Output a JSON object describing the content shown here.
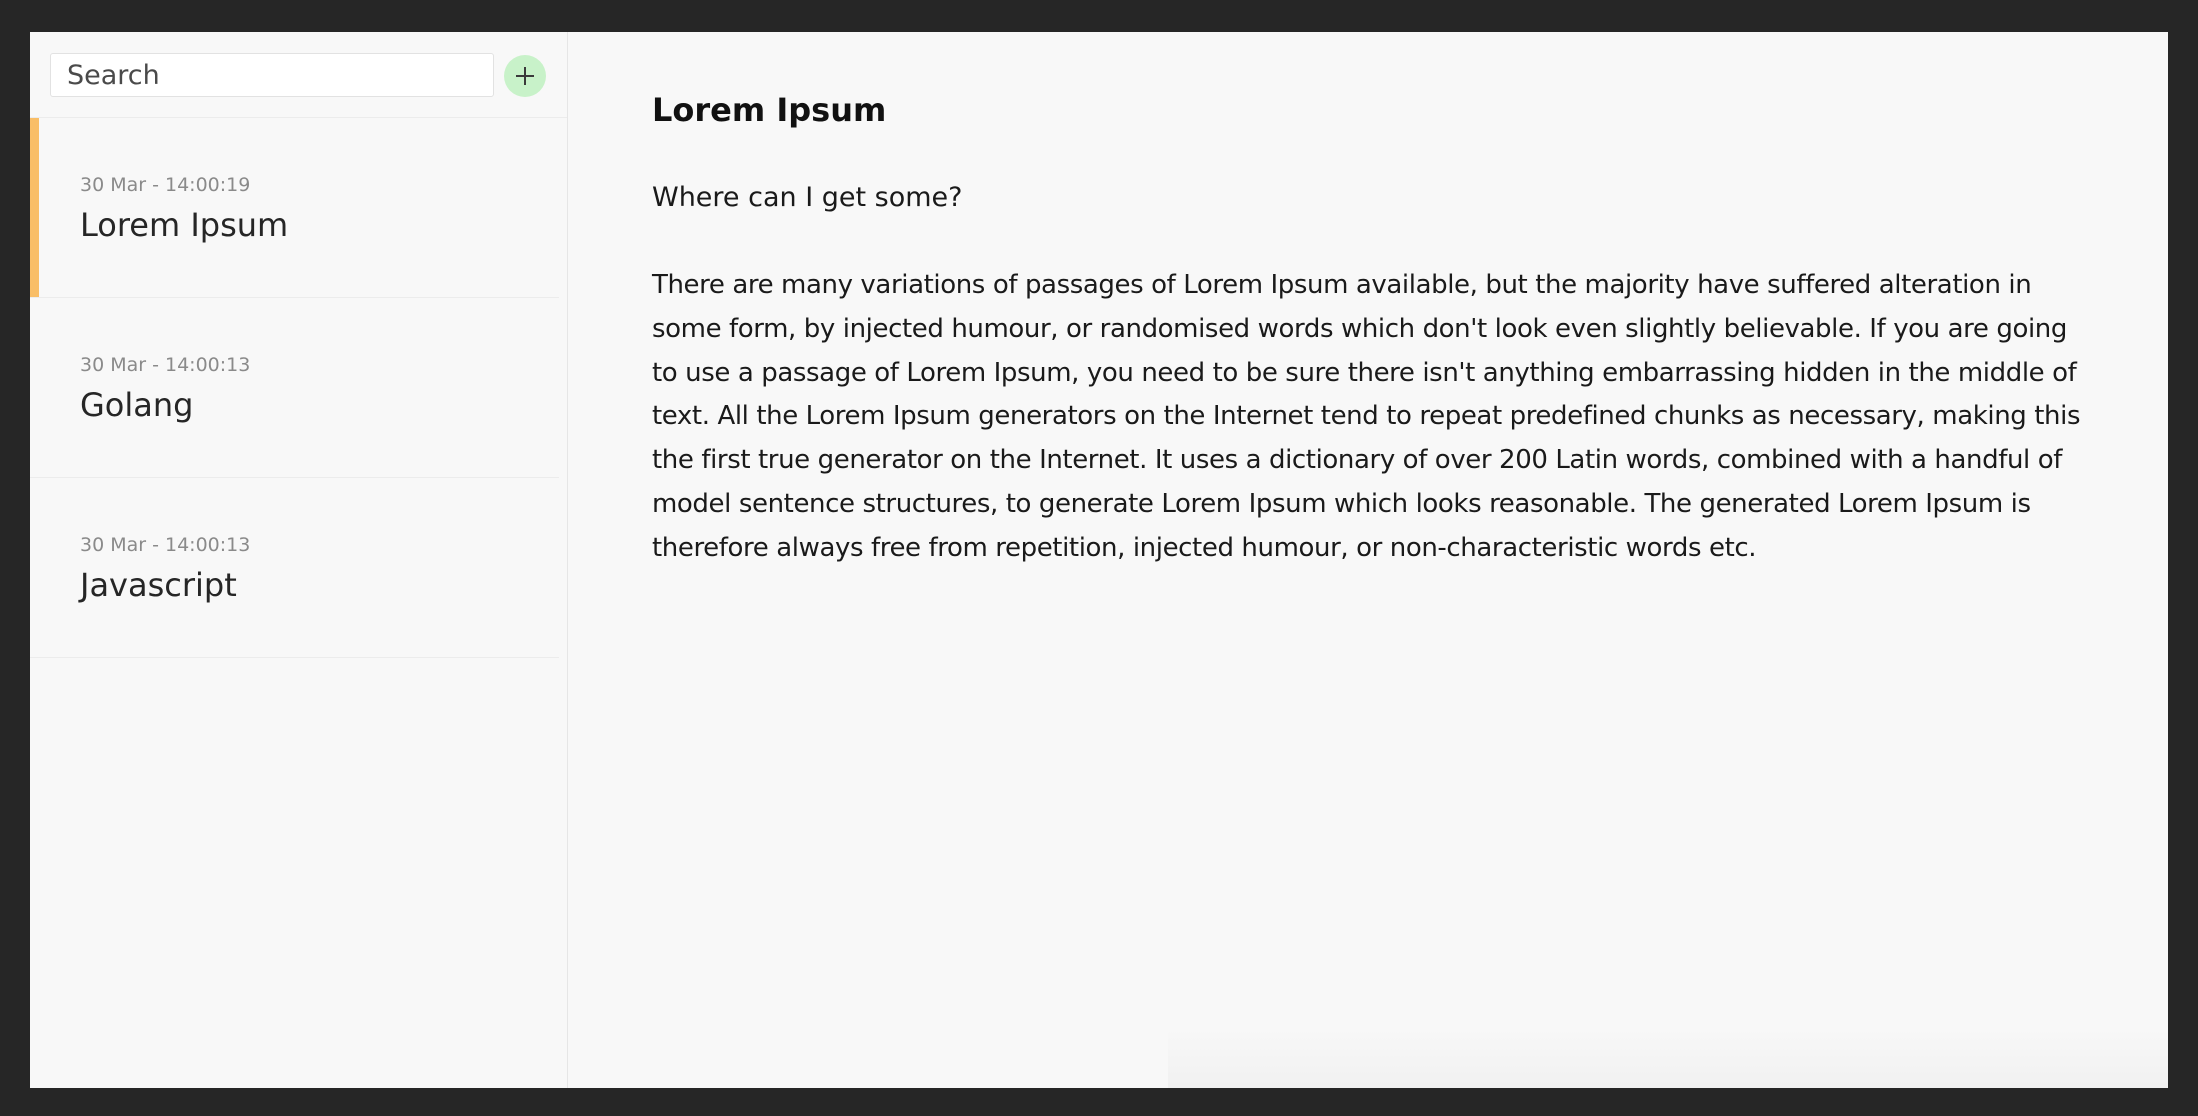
{
  "sidebar": {
    "search": {
      "placeholder": "Search",
      "value": ""
    },
    "add_button": {
      "icon": "plus-icon",
      "color": "#c8f2c9"
    },
    "notes": [
      {
        "date": "30 Mar - 14:00:19",
        "title": "Lorem Ipsum",
        "active": true
      },
      {
        "date": "30 Mar - 14:00:13",
        "title": "Golang",
        "active": false
      },
      {
        "date": "30 Mar - 14:00:13",
        "title": "Javascript",
        "active": false
      }
    ],
    "active_accent_color": "#f9be67"
  },
  "editor": {
    "title": "Lorem Ipsum",
    "subheading": "Where can I get some?",
    "body": "There are many variations of passages of Lorem Ipsum available, but the majority have suffered alteration in some form, by injected humour, or randomised words which don't look even slightly believable. If you are going to use a passage of Lorem Ipsum, you need to be sure there isn't anything embarrassing hidden in the middle of text. All the Lorem Ipsum generators on the Internet tend to repeat predefined chunks as necessary, making this the first true generator on the Internet. It uses a dictionary of over 200 Latin words, combined with a handful of model sentence structures, to generate Lorem Ipsum which looks reasonable. The generated Lorem Ipsum is therefore always free from repetition, injected humour, or non-characteristic words etc."
  }
}
